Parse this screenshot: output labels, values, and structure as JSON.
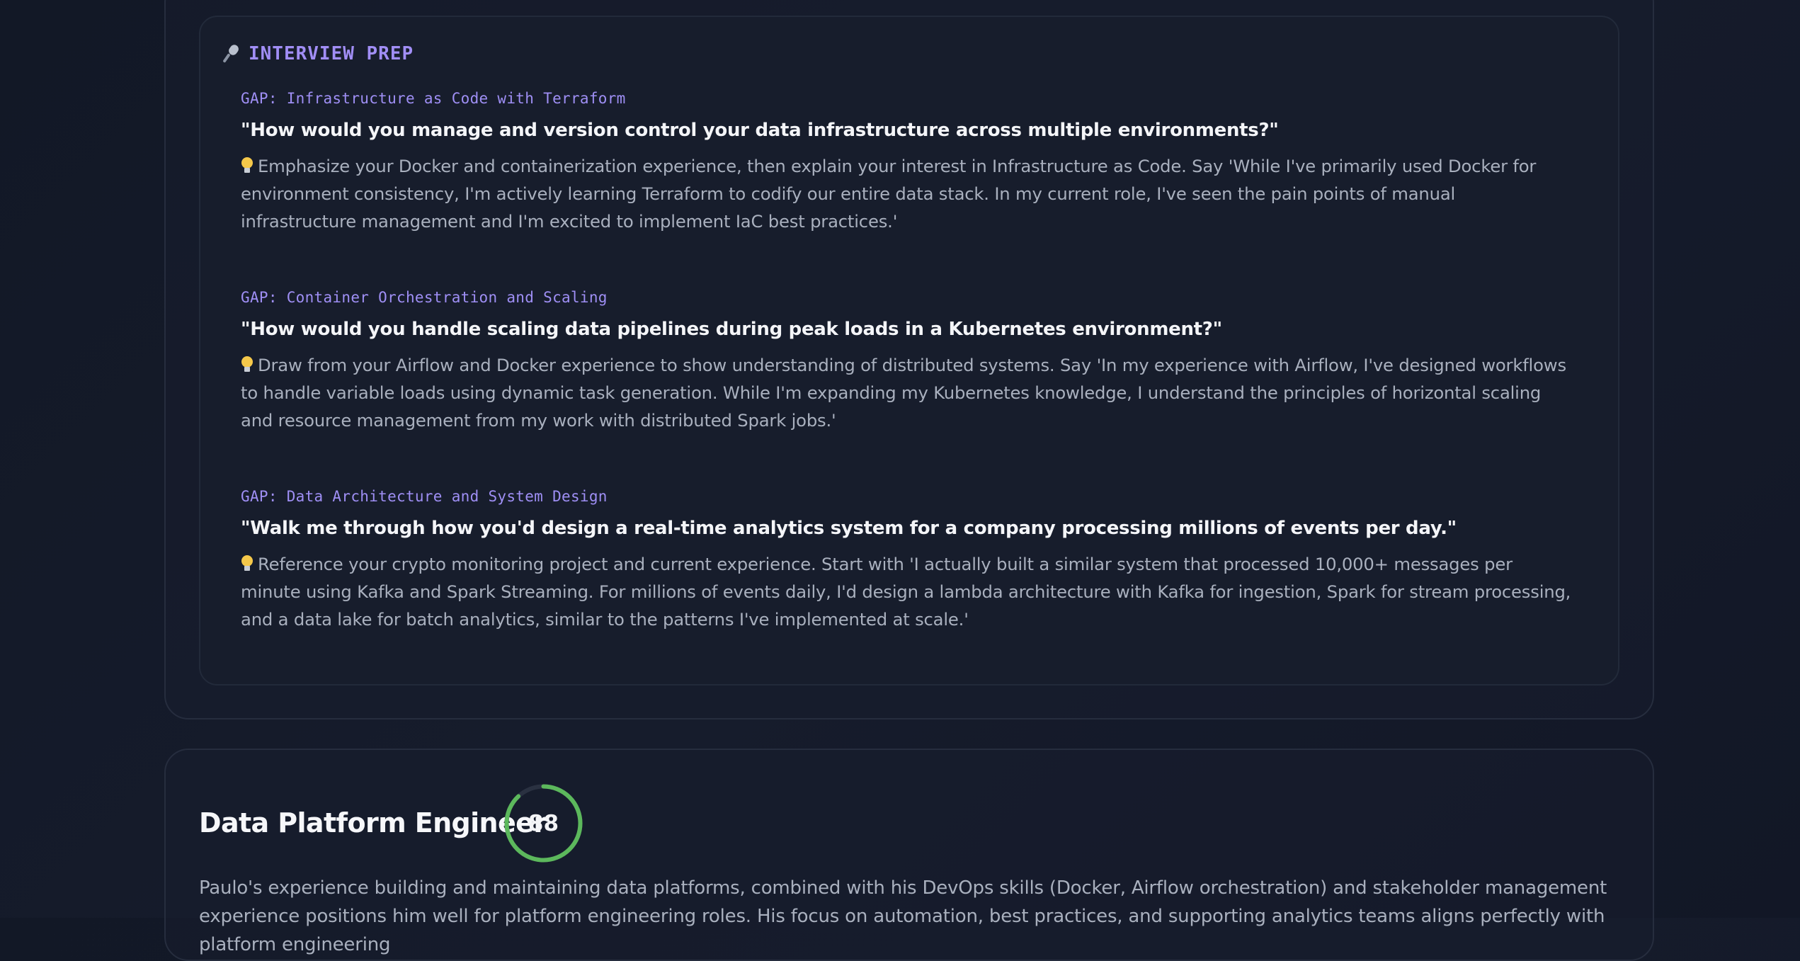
{
  "interview_prep": {
    "title": "INTERVIEW PREP",
    "icon": "microphone-icon",
    "gaps": [
      {
        "label": "GAP: Infrastructure as Code with Terraform",
        "question": "\"How would you manage and version control your data infrastructure across multiple environments?\"",
        "tip": "Emphasize your Docker and containerization experience, then explain your interest in Infrastructure as Code. Say 'While I've primarily used Docker for environment consistency, I'm actively learning Terraform to codify our entire data stack. In my current role, I've seen the pain points of manual infrastructure management and I'm excited to implement IaC best practices.'"
      },
      {
        "label": "GAP: Container Orchestration and Scaling",
        "question": "\"How would you handle scaling data pipelines during peak loads in a Kubernetes environment?\"",
        "tip": "Draw from your Airflow and Docker experience to show understanding of distributed systems. Say 'In my experience with Airflow, I've designed workflows to handle variable loads using dynamic task generation. While I'm expanding my Kubernetes knowledge, I understand the principles of horizontal scaling and resource management from my work with distributed Spark jobs.'"
      },
      {
        "label": "GAP: Data Architecture and System Design",
        "question": "\"Walk me through how you'd design a real-time analytics system for a company processing millions of events per day.\"",
        "tip": "Reference your crypto monitoring project and current experience. Start with 'I actually built a similar system that processed 10,000+ messages per minute using Kafka and Spark Streaming. For millions of events daily, I'd design a lambda architecture with Kafka for ingestion, Spark for stream processing, and a data lake for batch analytics, similar to the patterns I've implemented at scale.'"
      }
    ]
  },
  "role_match": {
    "title": "Data Platform Engineer",
    "score": 88,
    "score_display": "88",
    "score_color": "#5cb85c",
    "description": "Paulo's experience building and maintaining data platforms, combined with his DevOps skills (Docker, Airflow orchestration) and stakeholder management experience positions him well for platform engineering roles. His focus on automation, best practices, and supporting analytics teams aligns perfectly with platform engineering"
  }
}
